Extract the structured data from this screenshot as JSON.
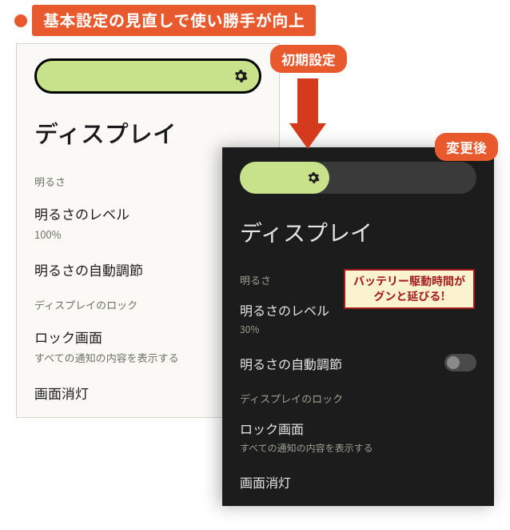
{
  "header": {
    "banner": "基本設定の見直しで使い勝手が向上"
  },
  "badges": {
    "initial": "初期設定",
    "after": "変更後"
  },
  "callout": {
    "line1": "バッテリー駆動時間が",
    "line2": "グンと延びる!"
  },
  "light": {
    "title": "ディスプレイ",
    "section_brightness": "明るさ",
    "brightness_level_label": "明るさのレベル",
    "brightness_level_value": "100%",
    "auto_brightness_label": "明るさの自動調節",
    "section_lock": "ディスプレイのロック",
    "lock_screen_label": "ロック画面",
    "lock_screen_sub": "すべての通知の内容を表示する",
    "screen_timeout_label": "画面消灯"
  },
  "dark": {
    "title": "ディスプレイ",
    "section_brightness": "明るさ",
    "brightness_level_label": "明るさのレベル",
    "brightness_level_value": "30%",
    "auto_brightness_label": "明るさの自動調節",
    "section_lock": "ディスプレイのロック",
    "lock_screen_label": "ロック画面",
    "lock_screen_sub": "すべての通知の内容を表示する",
    "screen_timeout_label": "画面消灯"
  }
}
